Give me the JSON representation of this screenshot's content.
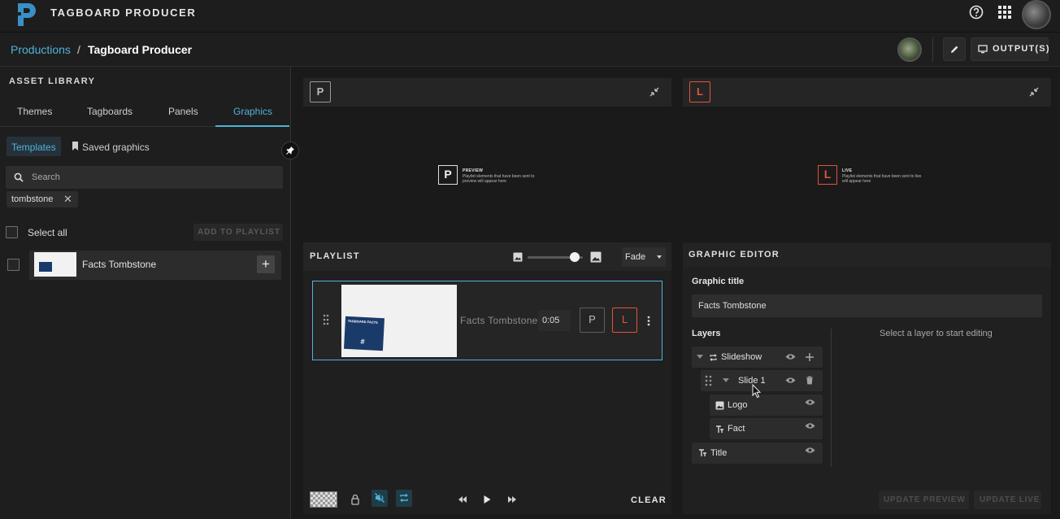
{
  "app": {
    "title": "TAGBOARD PRODUCER"
  },
  "breadcrumb": {
    "root": "Productions",
    "separator": "/",
    "current": "Tagboard Producer"
  },
  "header_actions": {
    "output_label": "OUTPUT(S)"
  },
  "asset_library": {
    "heading": "ASSET LIBRARY",
    "tabs": [
      {
        "label": "Themes"
      },
      {
        "label": "Tagboards"
      },
      {
        "label": "Panels"
      },
      {
        "label": "Graphics",
        "active": true
      }
    ],
    "subtabs": {
      "templates": "Templates",
      "saved": "Saved graphics"
    },
    "search": {
      "placeholder": "Search",
      "value": ""
    },
    "filters": [
      {
        "label": "tombstone"
      }
    ],
    "select_all_label": "Select all",
    "add_to_playlist_label": "ADD TO PLAYLIST",
    "items": [
      {
        "label": "Facts Tombstone"
      }
    ]
  },
  "preview": {
    "badge": "P",
    "mini_title": "PREVIEW",
    "mini_text": "Playlist elements that have been sent to preview will appear here"
  },
  "live": {
    "badge": "L",
    "mini_title": "LIVE",
    "mini_text": "Playlist elements that have been sent to live will appear here"
  },
  "playlist": {
    "title": "PLAYLIST",
    "transition": "Fade",
    "thumbnail_size_level": 0.85,
    "items": [
      {
        "label": "Facts Tombstone",
        "duration": "0:05",
        "preview_label": "P",
        "live_label": "L",
        "thumb_title": "TAGBOARD FACTS",
        "thumb_mark": "#"
      }
    ],
    "clear_label": "CLEAR"
  },
  "graphic_editor": {
    "title": "GRAPHIC EDITOR",
    "graphic_title_label": "Graphic title",
    "graphic_title_value": "Facts Tombstone",
    "layers_label": "Layers",
    "hint": "Select a layer to start editing",
    "layers": [
      {
        "label": "Slideshow"
      },
      {
        "label": "Slide 1"
      },
      {
        "label": "Logo"
      },
      {
        "label": "Fact"
      },
      {
        "label": "Title"
      }
    ],
    "update_preview_label": "UPDATE PREVIEW",
    "update_live_label": "UPDATE LIVE"
  },
  "colors": {
    "accent": "#4fb3d9",
    "live": "#e0553b",
    "background": "#1a1a1a"
  }
}
